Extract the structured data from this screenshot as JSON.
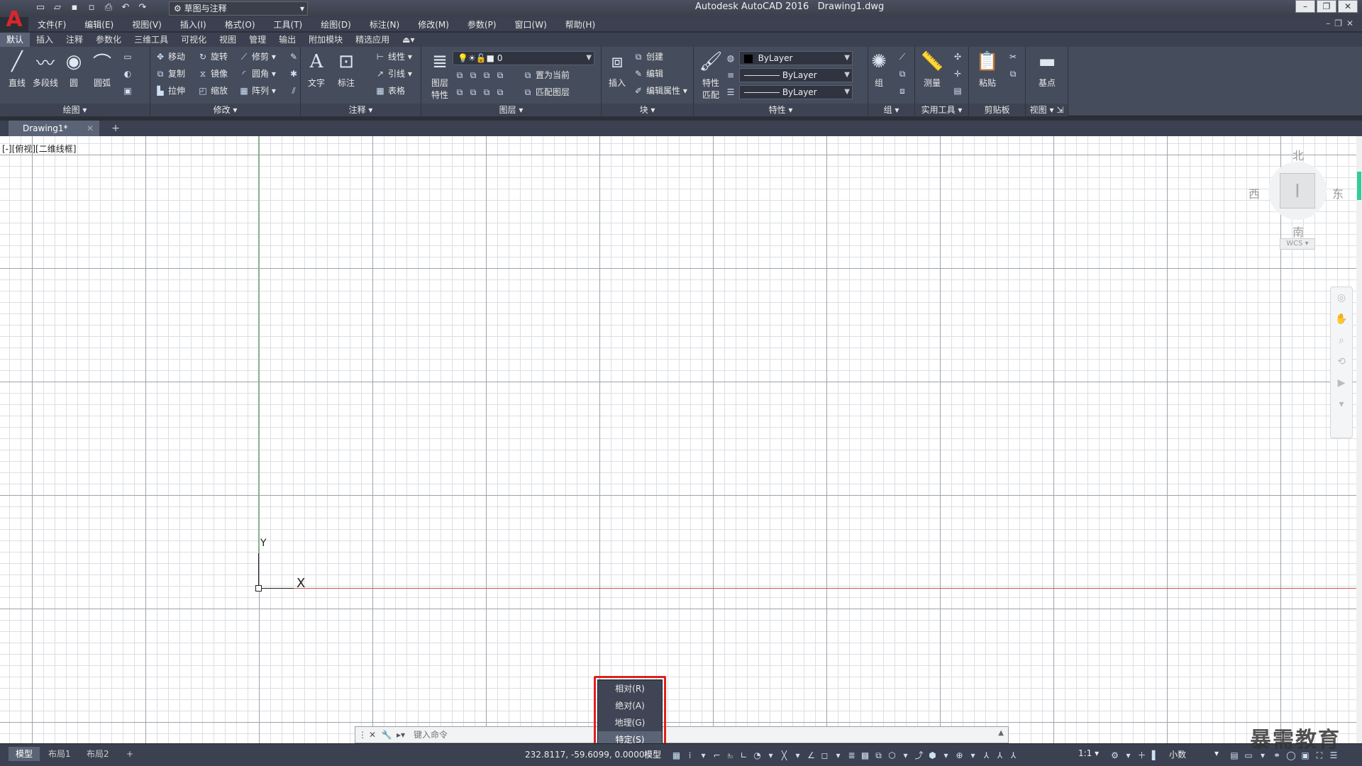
{
  "app": {
    "title": "Autodesk AutoCAD 2016",
    "document": "Drawing1.dwg",
    "workspace": "草图与注释",
    "logo_letter": "A"
  },
  "menu": [
    "文件(F)",
    "编辑(E)",
    "视图(V)",
    "插入(I)",
    "格式(O)",
    "工具(T)",
    "绘图(D)",
    "标注(N)",
    "修改(M)",
    "参数(P)",
    "窗口(W)",
    "帮助(H)"
  ],
  "ribbon_tabs": [
    "默认",
    "插入",
    "注释",
    "参数化",
    "三维工具",
    "可视化",
    "视图",
    "管理",
    "输出",
    "附加模块",
    "精选应用"
  ],
  "ribbon": {
    "draw": {
      "title": "绘图",
      "line": "直线",
      "polyline": "多段线",
      "circle": "圆",
      "arc": "圆弧"
    },
    "modify": {
      "title": "修改",
      "move": "移动",
      "rotate": "旋转",
      "trim": "修剪",
      "copy": "复制",
      "mirror": "镜像",
      "fillet": "圆角",
      "stretch": "拉伸",
      "scale": "缩放",
      "array": "阵列"
    },
    "annotation": {
      "title": "注释",
      "text": "文字",
      "dimension": "标注",
      "linear": "线性",
      "leader": "引线",
      "table": "表格"
    },
    "layers": {
      "title": "图层",
      "layer_props": "图层\n特性",
      "layer_value": "0",
      "set_current": "置为当前",
      "match_layer": "匹配图层"
    },
    "block": {
      "title": "块",
      "insert": "插入",
      "create": "创建",
      "edit": "编辑",
      "edit_attr": "编辑属性"
    },
    "properties": {
      "title": "特性",
      "match": "特性\n匹配",
      "color": "ByLayer",
      "linetype": "ByLayer",
      "lineweight": "ByLayer"
    },
    "groups": {
      "title": "组",
      "group": "组"
    },
    "utilities": {
      "title": "实用工具",
      "measure": "测量"
    },
    "clipboard": {
      "title": "剪贴板",
      "paste": "粘贴"
    },
    "view": {
      "title": "视图",
      "base": "基点"
    }
  },
  "doc_tab": "Drawing1*",
  "viewport_label": "[-][俯视][二维线框]",
  "viewcube": {
    "north": "北",
    "south": "南",
    "west": "西",
    "east": "东",
    "wcs": "WCS"
  },
  "ucs": {
    "x": "X",
    "y": "Y"
  },
  "command": {
    "placeholder": "键入命令"
  },
  "popup_menu": {
    "items": [
      "相对(R)",
      "绝对(A)",
      "地理(G)",
      "特定(S)"
    ],
    "selected_index": 3
  },
  "status": {
    "layouts": [
      "模型",
      "布局1",
      "布局2"
    ],
    "coords": "232.8117, -59.6099, 0.0000",
    "model": "模型",
    "scale": "1:1",
    "units": "小数"
  },
  "watermark": "暴需教育",
  "colors": {
    "x_axis": "#d35050",
    "y_axis": "#6fbf6f",
    "popup_highlight": "#e02020",
    "logo": "#d9262b"
  }
}
